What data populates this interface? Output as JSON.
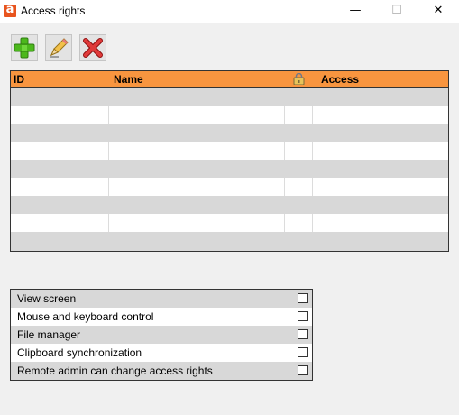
{
  "window": {
    "title": "Access rights",
    "app_icon_letter": "a",
    "controls": {
      "minimize": "—",
      "maximize": "☐",
      "close": "✕"
    }
  },
  "toolbar": {
    "add_icon": "plus-icon",
    "edit_icon": "pencil-icon",
    "delete_icon": "delete-x-icon"
  },
  "grid": {
    "columns": [
      "ID",
      "Name",
      "",
      "Access"
    ],
    "lock_icon": "lock-icon",
    "header_color": "#f8953f",
    "rows": [
      {
        "id": "",
        "name": "",
        "locked": "",
        "access": ""
      },
      {
        "id": "",
        "name": "",
        "locked": "",
        "access": ""
      },
      {
        "id": "",
        "name": "",
        "locked": "",
        "access": ""
      },
      {
        "id": "",
        "name": "",
        "locked": "",
        "access": ""
      },
      {
        "id": "",
        "name": "",
        "locked": "",
        "access": ""
      },
      {
        "id": "",
        "name": "",
        "locked": "",
        "access": ""
      },
      {
        "id": "",
        "name": "",
        "locked": "",
        "access": ""
      },
      {
        "id": "",
        "name": "",
        "locked": "",
        "access": ""
      },
      {
        "id": "",
        "name": "",
        "locked": "",
        "access": ""
      }
    ]
  },
  "permissions": [
    {
      "label": "View screen",
      "checked": false
    },
    {
      "label": "Mouse and keyboard control",
      "checked": false
    },
    {
      "label": "File manager",
      "checked": false
    },
    {
      "label": "Clipboard synchronization",
      "checked": false
    },
    {
      "label": "Remote admin can change access rights",
      "checked": false
    }
  ]
}
